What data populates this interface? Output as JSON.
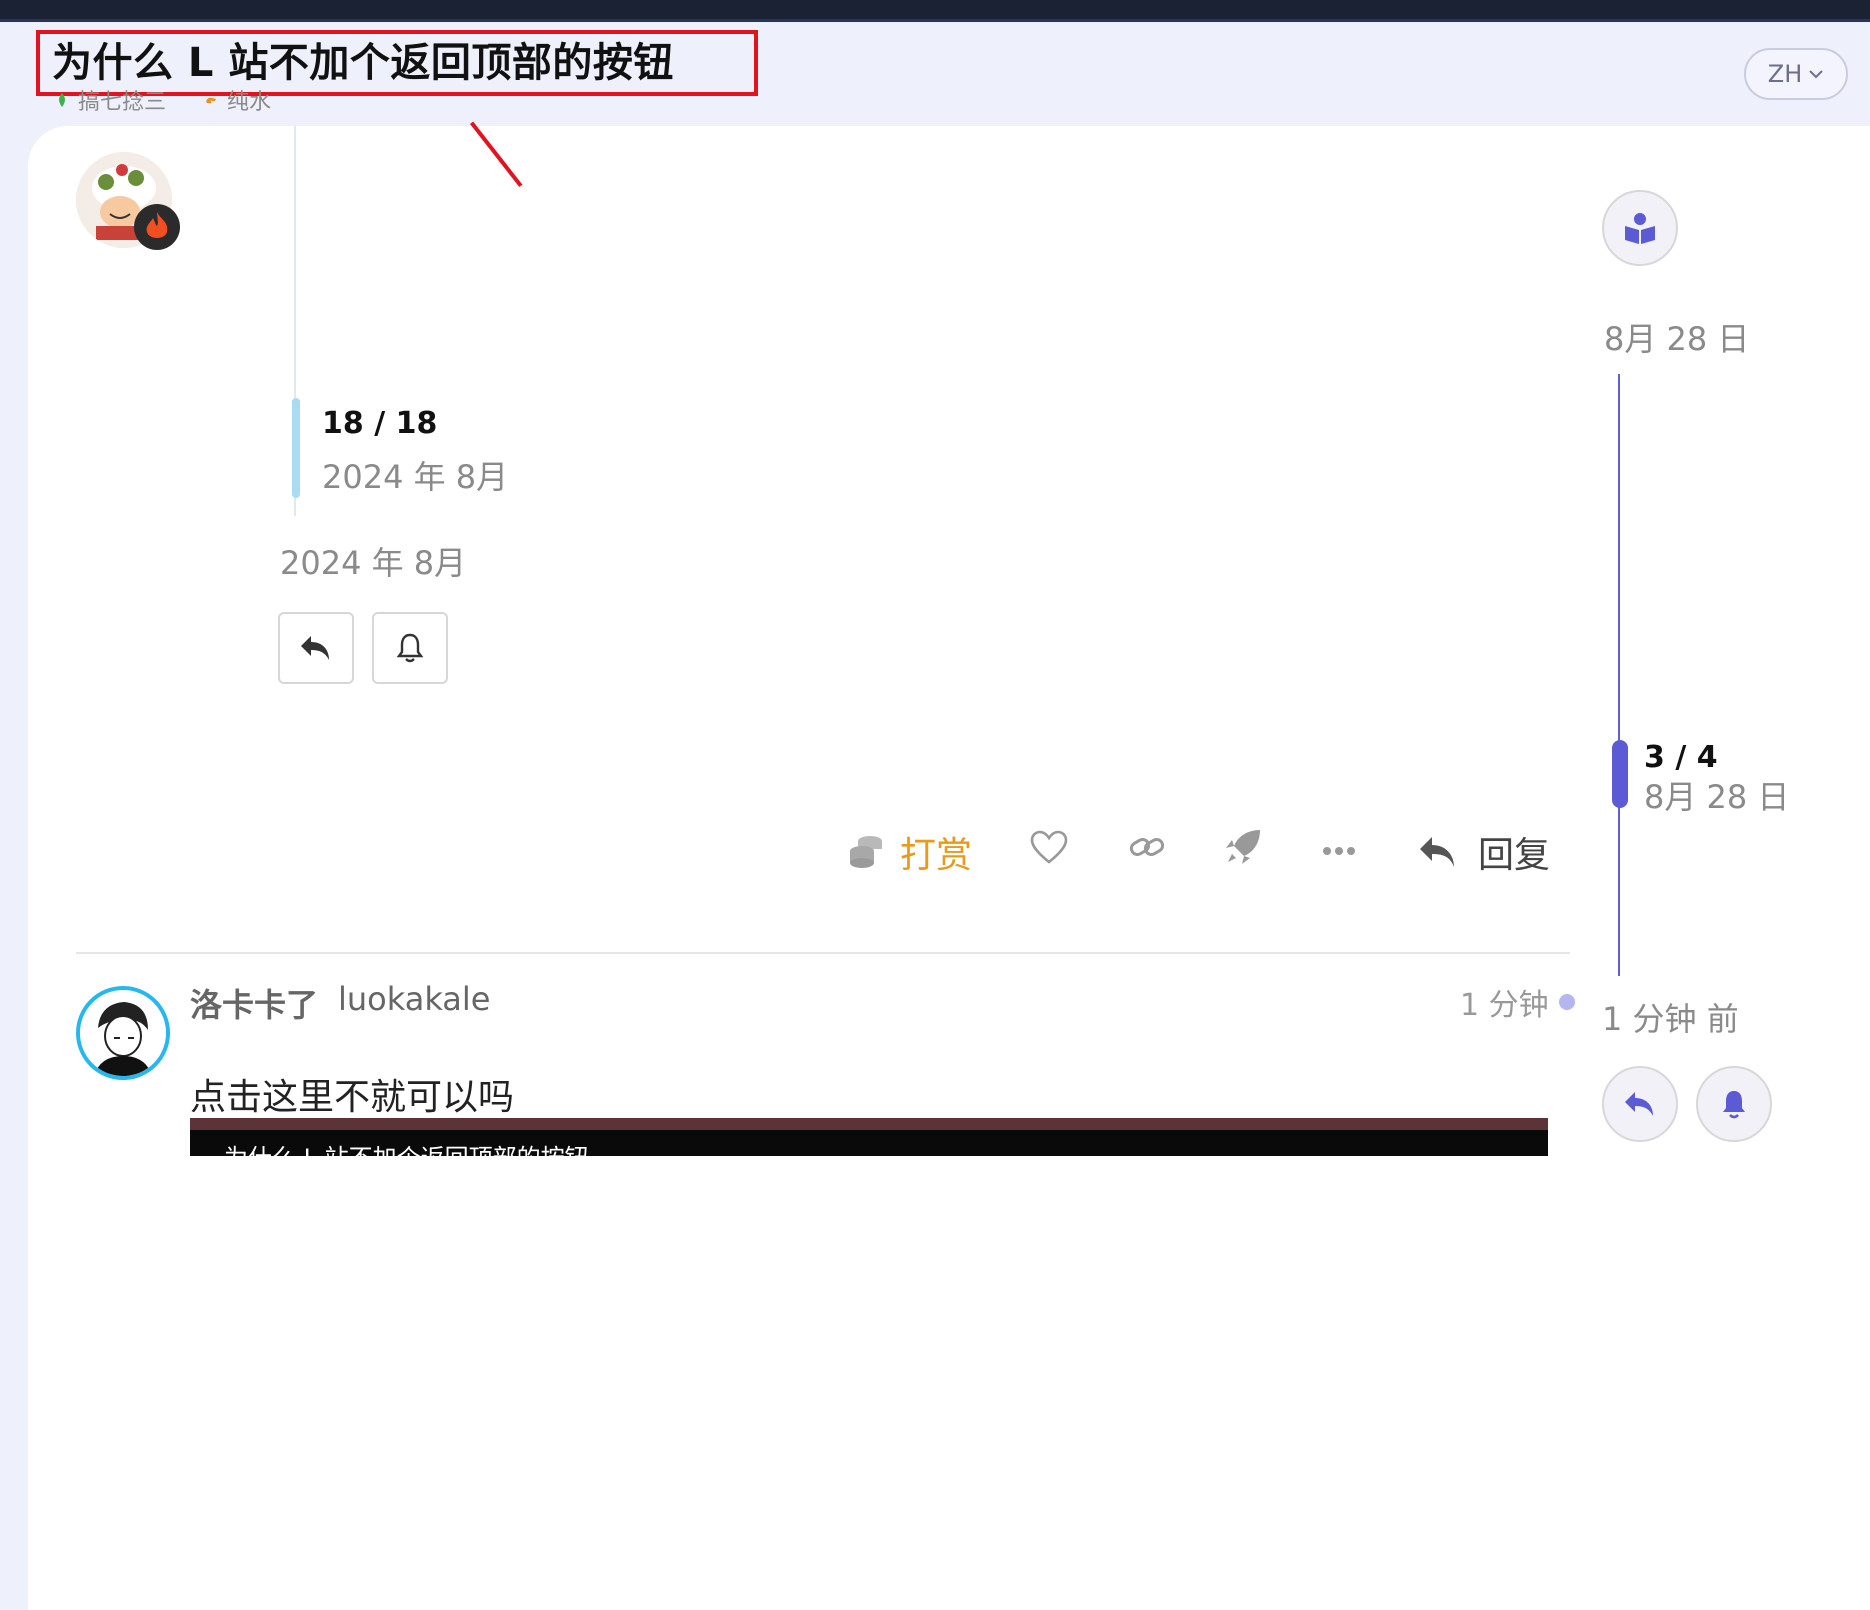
{
  "topic": {
    "title": "为什么 L 站不加个返回顶部的按钮",
    "tags": [
      {
        "label": "搞七捻三",
        "color": "#3bb34a",
        "icon": "leaf-icon"
      },
      {
        "label": "纯水",
        "color": "#f08c1e",
        "icon": "hand-icon"
      }
    ]
  },
  "header": {
    "lang_label": "ZH"
  },
  "post": {
    "mini_count": "18 / 18",
    "mini_date": "2024 年 8月",
    "date": "2024 年 8月",
    "actions": {
      "tip_label": "打赏",
      "reply_label": "回复"
    }
  },
  "reply_post": {
    "name": "洛卡卡了",
    "username": "luokakale",
    "age": "1 分钟",
    "body": "点击这里不就可以吗",
    "embed_title": "为什么 L 站不加个返回顶部的按钮"
  },
  "timeline": {
    "top_date": "8月 28 日",
    "count": "3 / 4",
    "current_date": "8月 28 日",
    "bottom_date": "1 分钟 前"
  },
  "colors": {
    "accent": "#5b5bd6",
    "tip": "#e79a1b",
    "highlight_box": "#e0141f"
  }
}
